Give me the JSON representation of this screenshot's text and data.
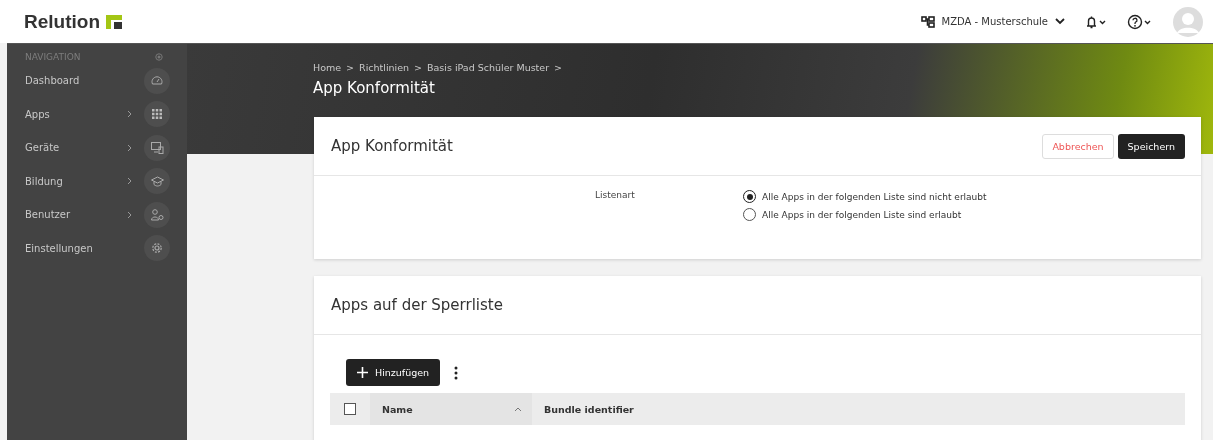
{
  "header": {
    "logo": "Relution",
    "org": "MZDA - Musterschule"
  },
  "sidebar": {
    "heading": "NAVIGATION",
    "items": [
      {
        "label": "Dashboard",
        "expandable": false
      },
      {
        "label": "Apps",
        "expandable": true
      },
      {
        "label": "Geräte",
        "expandable": true
      },
      {
        "label": "Bildung",
        "expandable": true
      },
      {
        "label": "Benutzer",
        "expandable": true
      },
      {
        "label": "Einstellungen",
        "expandable": false
      }
    ]
  },
  "breadcrumb": {
    "separator": ">",
    "items": [
      "Home",
      "Richtlinien",
      "Basis iPad Schüler Muster"
    ]
  },
  "page_title": "App Konformität",
  "settings_card": {
    "title": "App Konformität",
    "buttons": {
      "cancel": "Abbrechen",
      "save": "Speichern"
    },
    "field_label": "Listenart",
    "options": [
      {
        "label": "Alle Apps in der folgenden Liste sind nicht erlaubt",
        "selected": true
      },
      {
        "label": "Alle Apps in der folgenden Liste sind erlaubt",
        "selected": false
      }
    ]
  },
  "blocklist_card": {
    "title": "Apps auf der Sperrliste",
    "add_button": "Hinzufügen",
    "table": {
      "all_checked": false,
      "columns": [
        {
          "label": "Name",
          "sorted": true
        },
        {
          "label": "Bundle identifier",
          "sorted": false
        }
      ]
    }
  }
}
